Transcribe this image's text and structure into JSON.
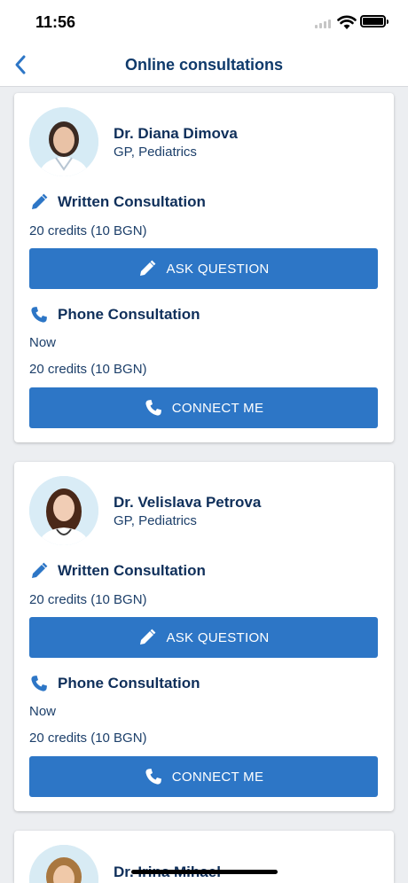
{
  "status": {
    "time": "11:56"
  },
  "nav": {
    "title": "Online consultations"
  },
  "doctors": [
    {
      "name": "Dr. Diana Dimova",
      "specialty": "GP, Pediatrics",
      "written": {
        "title": "Written Consultation",
        "price": "20 credits (10 BGN)",
        "button": "ASK QUESTION"
      },
      "phone": {
        "title": "Phone Consultation",
        "availability": "Now",
        "price": "20 credits (10 BGN)",
        "button": "CONNECT ME"
      }
    },
    {
      "name": "Dr. Velislava Petrova",
      "specialty": "GP, Pediatrics",
      "written": {
        "title": "Written Consultation",
        "price": "20 credits (10 BGN)",
        "button": "ASK QUESTION"
      },
      "phone": {
        "title": "Phone Consultation",
        "availability": "Now",
        "price": "20 credits (10 BGN)",
        "button": "CONNECT ME"
      }
    },
    {
      "name": "Dr. Irina Mihael"
    }
  ],
  "colors": {
    "accent": "#2d76c6",
    "title_text": "#0f2f5a",
    "background": "#eceef1"
  },
  "icons": {
    "back": "chevron-left-icon",
    "written": "pencil-icon",
    "phone": "phone-icon"
  }
}
